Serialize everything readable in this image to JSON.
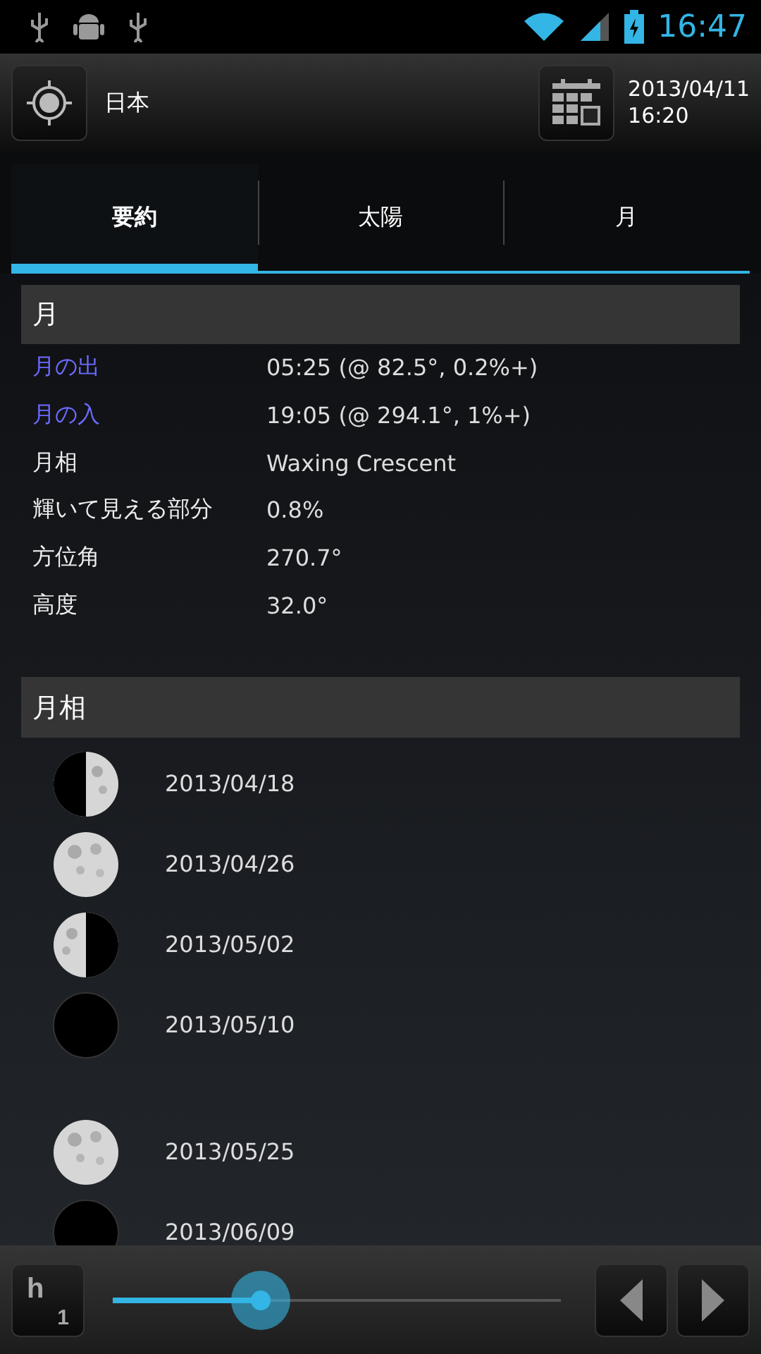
{
  "status_bar": {
    "time": "16:47"
  },
  "toolbar": {
    "location": "日本",
    "date": "2013/04/11",
    "time": "16:20"
  },
  "tabs": [
    {
      "label": "要約",
      "selected": true
    },
    {
      "label": "太陽",
      "selected": false
    },
    {
      "label": "月",
      "selected": false
    }
  ],
  "moon_section": {
    "title": "月",
    "rows": [
      {
        "label": "月の出",
        "value": "05:25 (@ 82.5°, 0.2%+)",
        "highlight": true
      },
      {
        "label": "月の入",
        "value": "19:05 (@ 294.1°, 1%+)",
        "highlight": true
      },
      {
        "label": "月相",
        "value": "Waxing Crescent",
        "highlight": false
      },
      {
        "label": "輝いて見える部分",
        "value": "0.8%",
        "highlight": false
      },
      {
        "label": "方位角",
        "value": "270.7°",
        "highlight": false
      },
      {
        "label": "高度",
        "value": "32.0°",
        "highlight": false
      }
    ]
  },
  "phases_section": {
    "title": "月相",
    "items": [
      {
        "kind": "first_quarter",
        "date": "2013/04/18",
        "spaced": false
      },
      {
        "kind": "full",
        "date": "2013/04/26",
        "spaced": false
      },
      {
        "kind": "last_quarter",
        "date": "2013/05/02",
        "spaced": false
      },
      {
        "kind": "new",
        "date": "2013/05/10",
        "spaced": false
      },
      {
        "kind": "full",
        "date": "2013/05/25",
        "spaced": true
      },
      {
        "kind": "new",
        "date": "2013/06/09",
        "spaced": false
      }
    ]
  },
  "bottom_bar": {
    "step_unit": "h",
    "step_count": "1",
    "slider": {
      "level": 0.33
    }
  }
}
